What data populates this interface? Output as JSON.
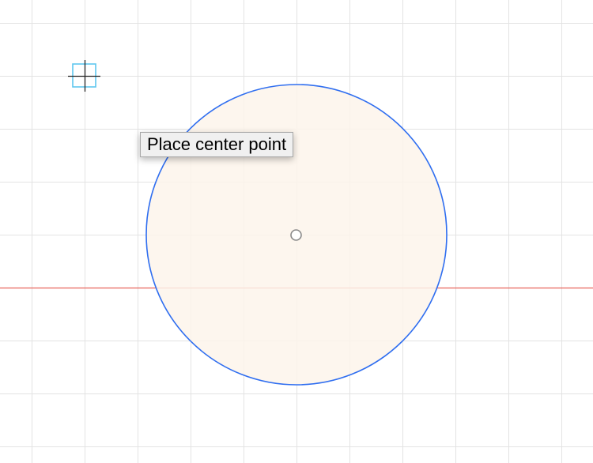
{
  "canvas": {
    "background": "#ffffff",
    "grid_color": "#e3e3e3",
    "guide_line_color": "#e8635a",
    "circle_stroke_color": "#2f6ef0",
    "circle_fill_color": "#fdf5eb",
    "cursor_icon": "crosshair-cursor-icon",
    "center_marker_icon": "center-point-icon"
  },
  "tooltip": {
    "text": "Place center point"
  }
}
